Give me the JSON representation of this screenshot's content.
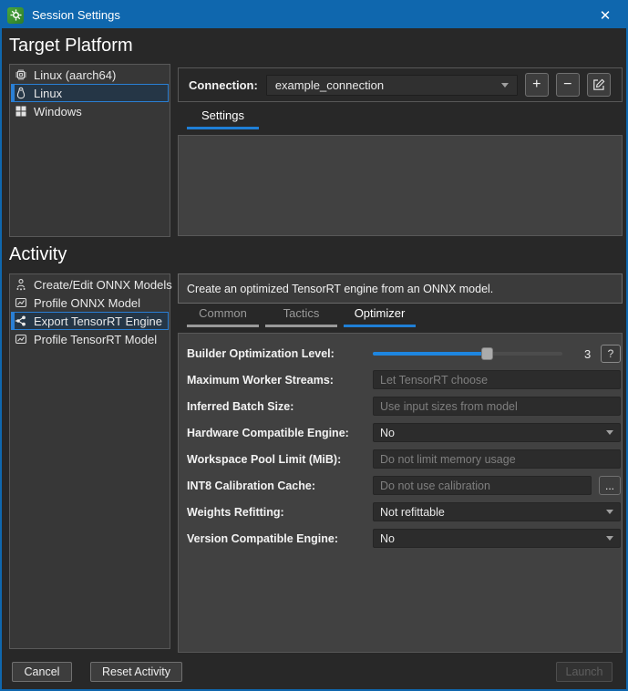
{
  "titlebar": {
    "title": "Session Settings",
    "close": "✕"
  },
  "colors": {
    "titlebar_blue": "#0f67ae",
    "accent_blue": "#1f7fd6",
    "slider_blue": "#1e86e0",
    "selection_border": "#2a7fd4",
    "app_icon_green": "#3a9e33"
  },
  "target_platform": {
    "heading": "Target Platform",
    "items": [
      {
        "label": "Linux (aarch64)",
        "icon": "chip-icon",
        "selected": false
      },
      {
        "label": "Linux",
        "icon": "tux-icon",
        "selected": true
      },
      {
        "label": "Windows",
        "icon": "windows-icon",
        "selected": false
      }
    ],
    "connection": {
      "label": "Connection:",
      "value": "example_connection",
      "add": "+",
      "remove": "−"
    },
    "settings_tab": "Settings"
  },
  "activity": {
    "heading": "Activity",
    "items": [
      {
        "label": "Create/Edit ONNX Models",
        "icon": "person-network-icon",
        "selected": false
      },
      {
        "label": "Profile ONNX Model",
        "icon": "chart-icon",
        "selected": false
      },
      {
        "label": "Export TensorRT Engine",
        "icon": "network-graph-icon",
        "selected": true
      },
      {
        "label": "Profile TensorRT Model",
        "icon": "chart-icon",
        "selected": false
      }
    ],
    "description": "Create an optimized TensorRT engine from an ONNX model.",
    "tabs": [
      {
        "label": "Common",
        "active": false
      },
      {
        "label": "Tactics",
        "active": false
      },
      {
        "label": "Optimizer",
        "active": true
      }
    ],
    "form": {
      "slider_fraction": 0.6,
      "rows": [
        {
          "label": "Builder Optimization Level:",
          "type": "slider",
          "value": "3",
          "help": "?"
        },
        {
          "label": "Maximum Worker Streams:",
          "type": "input",
          "placeholder": "Let TensorRT choose"
        },
        {
          "label": "Inferred Batch Size:",
          "type": "input",
          "placeholder": "Use input sizes from model"
        },
        {
          "label": "Hardware Compatible Engine:",
          "type": "select",
          "value": "No"
        },
        {
          "label": "Workspace Pool Limit (MiB):",
          "type": "input",
          "placeholder": "Do not limit memory usage"
        },
        {
          "label": "INT8 Calibration Cache:",
          "type": "input-browse",
          "placeholder": "Do not use calibration",
          "browse": "..."
        },
        {
          "label": "Weights Refitting:",
          "type": "select",
          "value": "Not refittable"
        },
        {
          "label": "Version Compatible Engine:",
          "type": "select",
          "value": "No"
        }
      ]
    }
  },
  "footer": {
    "cancel": "Cancel",
    "reset": "Reset Activity",
    "launch": "Launch"
  }
}
